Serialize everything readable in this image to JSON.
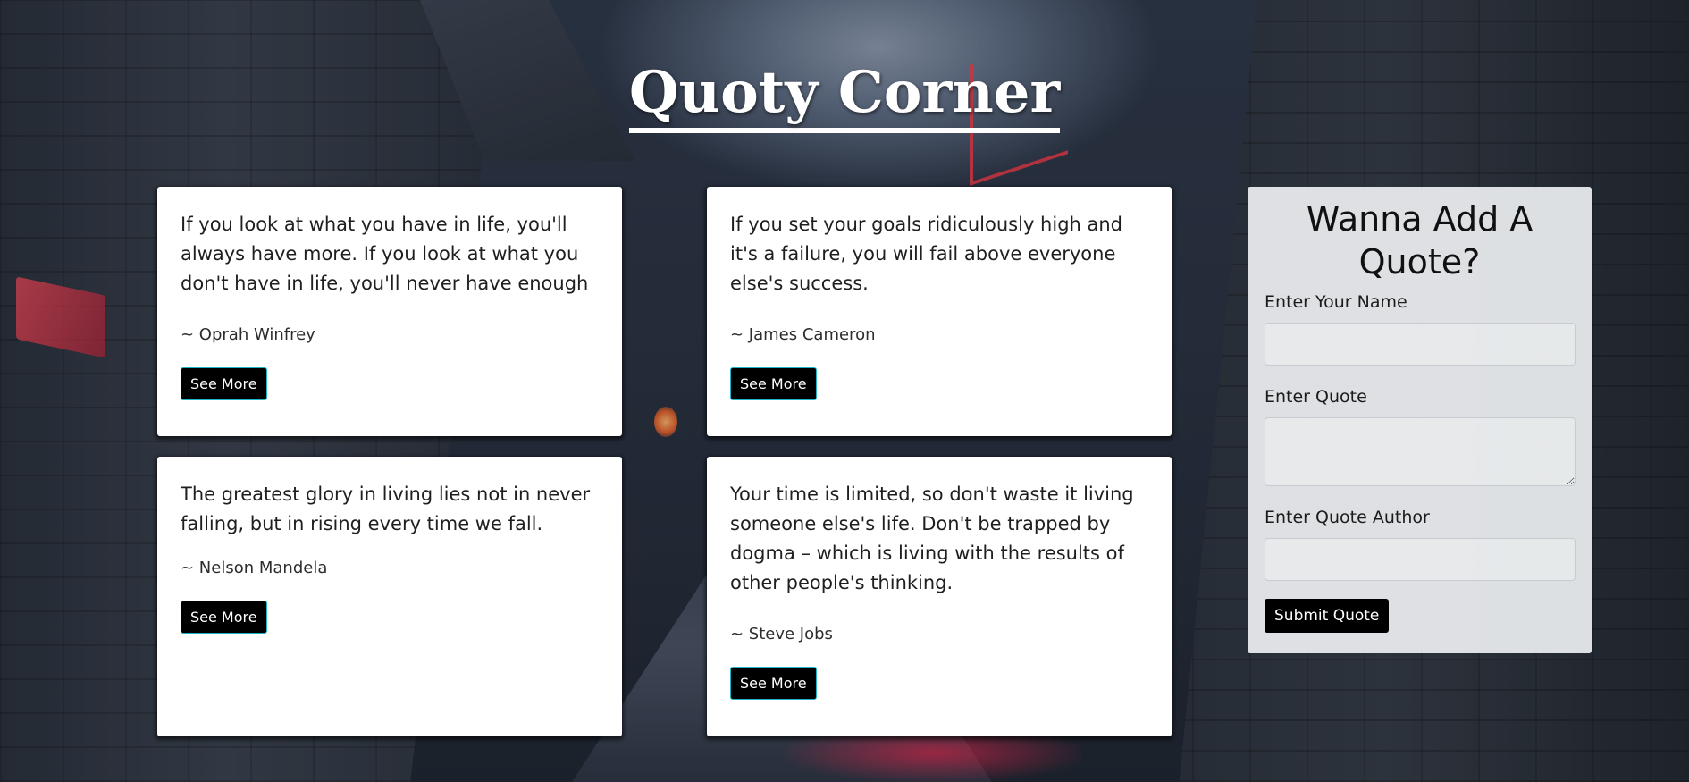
{
  "header": {
    "title": "Quoty Corner"
  },
  "quotes": [
    {
      "text": "If you look at what you have in life, you'll always have more. If you look at what you don't have in life, you'll never have enough",
      "author": "~ Oprah Winfrey",
      "button": "See More"
    },
    {
      "text": "If you set your goals ridiculously high and it's a failure, you will fail above everyone else's success.",
      "author": "~ James Cameron",
      "button": "See More"
    },
    {
      "text": "The greatest glory in living lies not in never falling, but in rising every time we fall.",
      "author": "~ Nelson Mandela",
      "button": "See More"
    },
    {
      "text": "Your time is limited, so don't waste it living someone else's life. Don't be trapped by dogma – which is living with the results of other people's thinking.",
      "author": "~ Steve Jobs",
      "button": "See More"
    }
  ],
  "form": {
    "heading": "Wanna Add A Quote?",
    "name_label": "Enter Your Name",
    "name_value": "",
    "quote_label": "Enter Quote",
    "quote_value": "",
    "author_label": "Enter Quote Author",
    "author_value": "",
    "submit_label": "Submit Quote"
  },
  "colors": {
    "card_bg": "#ffffff",
    "button_bg": "#000000",
    "button_border": "#1fb5c7",
    "form_bg": "#eceef0"
  }
}
